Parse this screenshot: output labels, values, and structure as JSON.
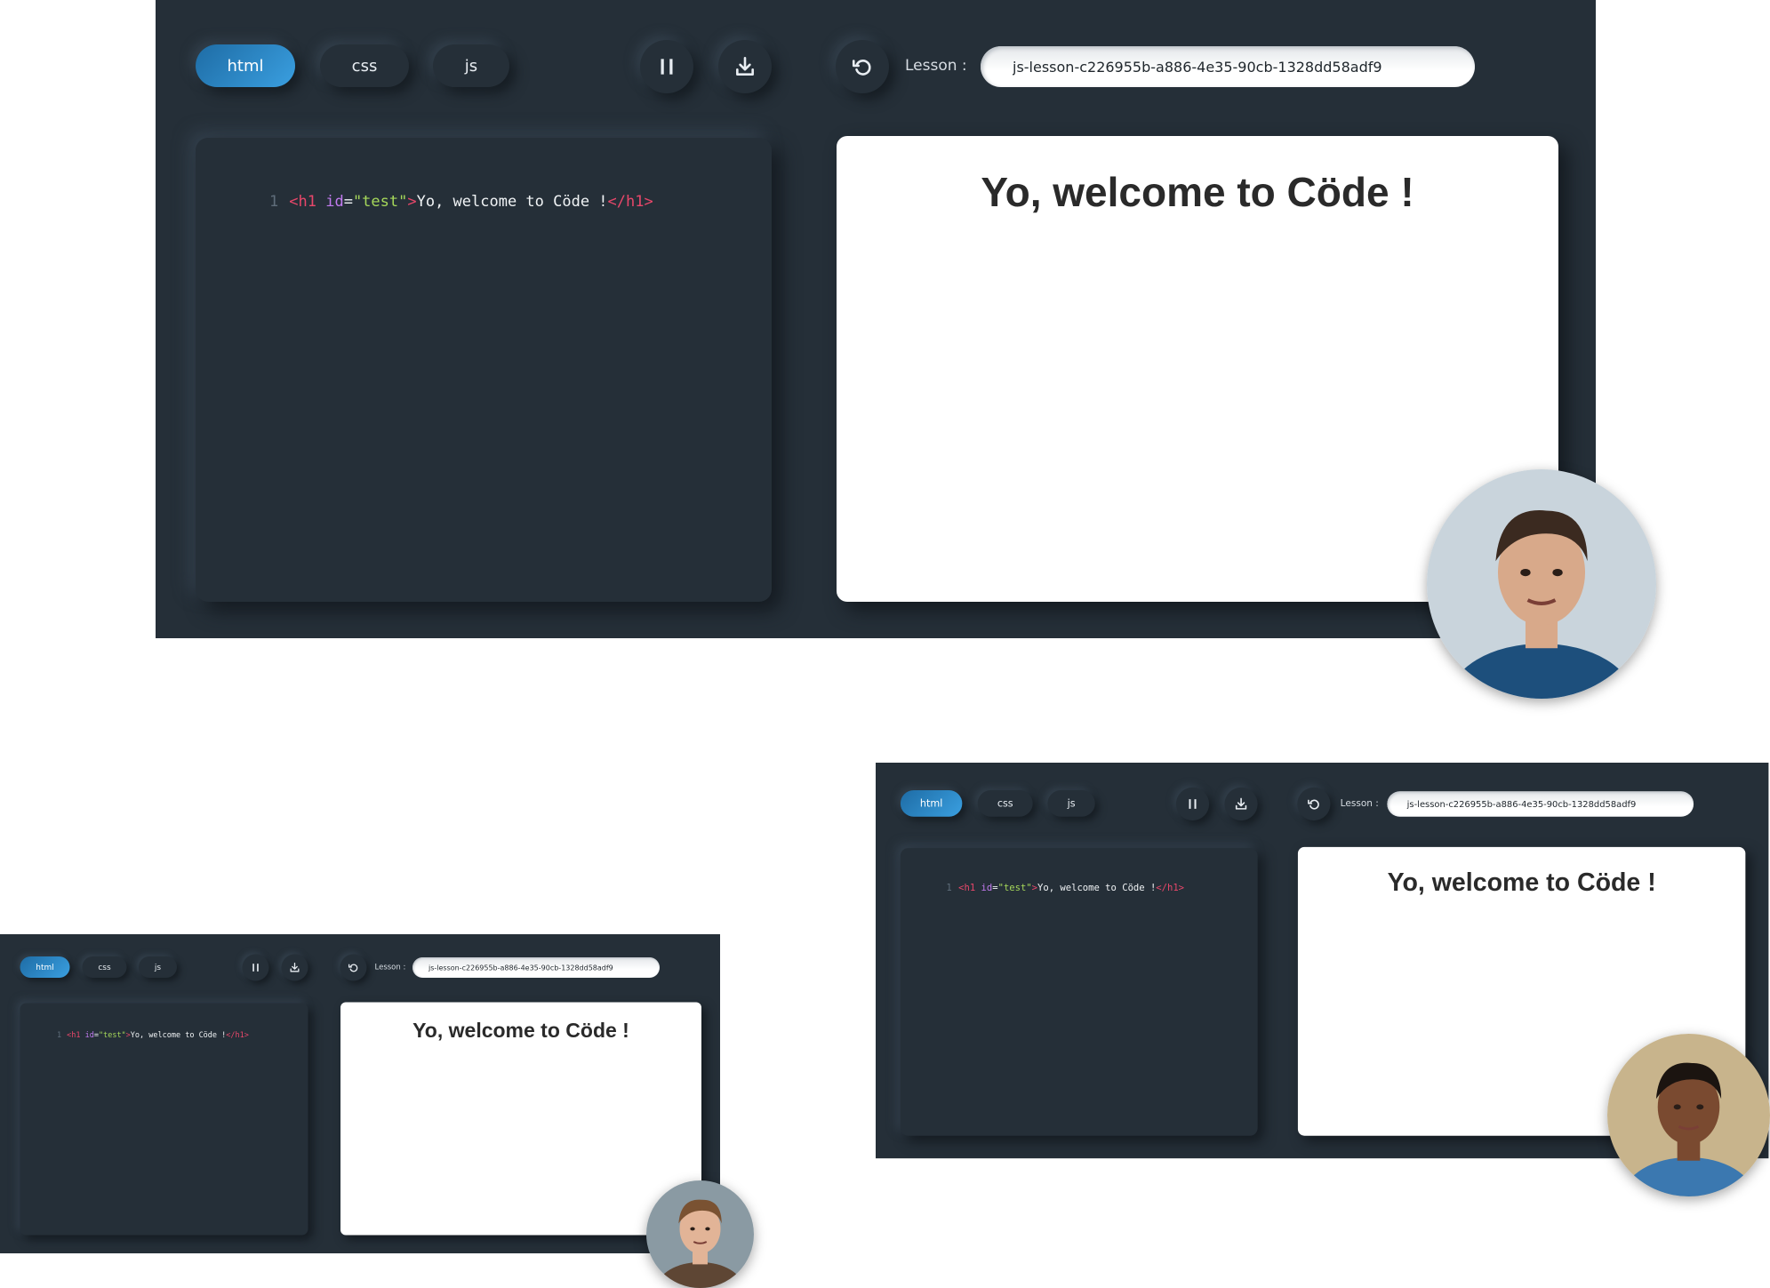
{
  "screens": [
    {
      "name": "large-view",
      "tabs": [
        {
          "label": "html",
          "active": true
        },
        {
          "label": "css",
          "active": false
        },
        {
          "label": "js",
          "active": false
        }
      ],
      "icons": {
        "pause": "pause-icon",
        "download": "download-icon",
        "reset": "reset-icon"
      },
      "lesson_label": "Lesson :",
      "lesson_value": "js-lesson-c226955b-a886-4e35-90cb-1328dd58adf9",
      "code": {
        "line_number": "1",
        "open_tag": "<h1",
        "attr_name": " id",
        "equals": "=",
        "attr_value": "\"test\"",
        "close_open": ">",
        "text": "Yo, welcome to Cöde !",
        "close_tag": "</h1>"
      },
      "preview_heading": "Yo, welcome to Cöde !"
    },
    {
      "name": "right-view",
      "tabs": [
        {
          "label": "html",
          "active": true
        },
        {
          "label": "css",
          "active": false
        },
        {
          "label": "js",
          "active": false
        }
      ],
      "icons": {
        "pause": "pause-icon",
        "download": "download-icon",
        "reset": "reset-icon"
      },
      "lesson_label": "Lesson :",
      "lesson_value": "js-lesson-c226955b-a886-4e35-90cb-1328dd58adf9",
      "code": {
        "line_number": "1",
        "open_tag": "<h1",
        "attr_name": " id",
        "equals": "=",
        "attr_value": "\"test\"",
        "close_open": ">",
        "text": "Yo, welcome to Cöde !",
        "close_tag": "</h1>"
      },
      "preview_heading": "Yo, welcome to Cöde !"
    },
    {
      "name": "left-view",
      "tabs": [
        {
          "label": "html",
          "active": true
        },
        {
          "label": "css",
          "active": false
        },
        {
          "label": "js",
          "active": false
        }
      ],
      "icons": {
        "pause": "pause-icon",
        "download": "download-icon",
        "reset": "reset-icon"
      },
      "lesson_label": "Lesson :",
      "lesson_value": "js-lesson-c226955b-a886-4e35-90cb-1328dd58adf9",
      "code": {
        "line_number": "1",
        "open_tag": "<h1",
        "attr_name": " id",
        "equals": "=",
        "attr_value": "\"test\"",
        "close_open": ">",
        "text": "Yo, welcome to Cöde !",
        "close_tag": "</h1>"
      },
      "preview_heading": "Yo, welcome to Cöde !"
    }
  ],
  "avatars": [
    {
      "name": "presenter-avatar-man",
      "skin": "#d8a98a",
      "hair": "#3b2a20",
      "bg": "#c9d4dc",
      "shirt": "#1d4f7c"
    },
    {
      "name": "presenter-avatar-man-glasses",
      "skin": "#7a4a30",
      "hair": "#1b1410",
      "bg": "#c8b48c",
      "shirt": "#3b78b0"
    },
    {
      "name": "presenter-avatar-woman",
      "skin": "#e2b497",
      "hair": "#7a5232",
      "bg": "#8a9aa3",
      "shirt": "#5e4634"
    }
  ],
  "colors": {
    "panel_bg": "#252f38",
    "accent": "#2f8fd4",
    "tag": "#e8476a",
    "attr": "#c27bf0",
    "string": "#a6d85a"
  }
}
